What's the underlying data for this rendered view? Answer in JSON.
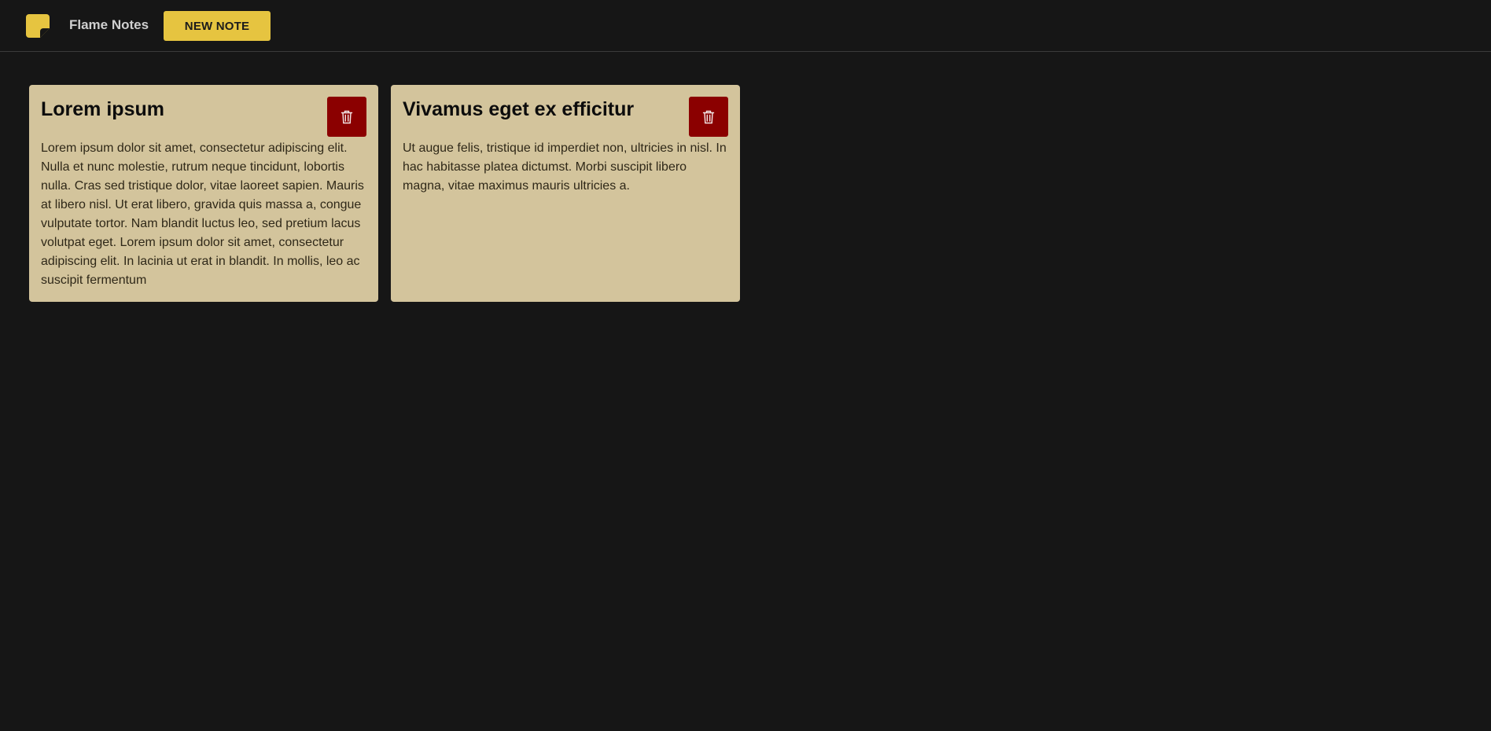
{
  "header": {
    "logo_icon": "sticky-note-icon",
    "title": "Flame Notes",
    "new_note_label": "NEW NOTE"
  },
  "notes": [
    {
      "title": "Lorem ipsum",
      "body": "Lorem ipsum dolor sit amet, consectetur adipiscing elit. Nulla et nunc molestie, rutrum neque tincidunt, lobortis nulla. Cras sed tristique dolor, vitae laoreet sapien. Mauris at libero nisl. Ut erat libero, gravida quis massa a, congue vulputate tortor. Nam blandit luctus leo, sed pretium lacus volutpat eget. Lorem ipsum dolor sit amet, consectetur adipiscing elit. In lacinia ut erat in blandit. In mollis, leo ac suscipit fermentum",
      "delete_icon": "trash-icon"
    },
    {
      "title": "Vivamus eget ex efficitur",
      "body": "Ut augue felis, tristique id imperdiet non, ultricies in nisl. In hac habitasse platea dictumst. Morbi suscipit libero magna, vitae maximus mauris ultricies a.",
      "delete_icon": "trash-icon"
    }
  ],
  "colors": {
    "background": "#161616",
    "accent": "#e6c440",
    "note_background": "#d3c49c",
    "delete_button": "#8b0000"
  }
}
